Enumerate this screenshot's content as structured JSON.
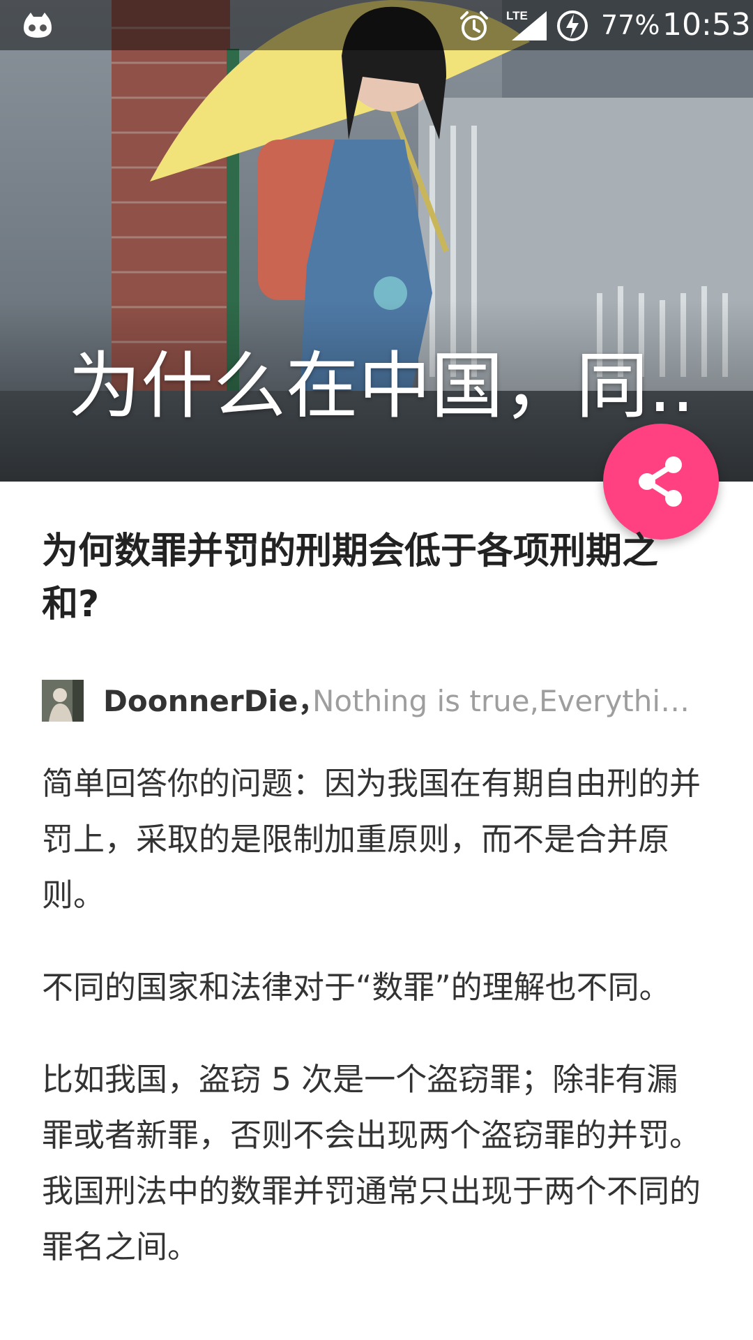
{
  "status_bar": {
    "battery_percent": "77%",
    "time": "10:53",
    "network": "LTE",
    "icons": [
      "cyanogenmod-icon",
      "alarm-icon",
      "lte-signal-icon",
      "battery-charging-icon"
    ]
  },
  "hero": {
    "title": "为什么在中国，同..."
  },
  "fab": {
    "icon": "share-icon",
    "color": "#ff4081"
  },
  "article": {
    "question": "为何数罪并罚的刑期会低于各项刑期之和?",
    "author": {
      "name": "DoonnerDie，",
      "bio": "Nothing is true,Everything is permitted"
    },
    "paragraphs": [
      "简单回答你的问题：因为我国在有期自由刑的并罚上，采取的是限制加重原则，而不是合并原则。",
      "不同的国家和法律对于“数罪”的理解也不同。",
      "比如我国，盗窃 5 次是一个盗窃罪；除非有漏罪或者新罪，否则不会出现两个盗窃罪的并罚。我国刑法中的数罪并罚通常只出现于两个不同的罪名之间。"
    ]
  }
}
